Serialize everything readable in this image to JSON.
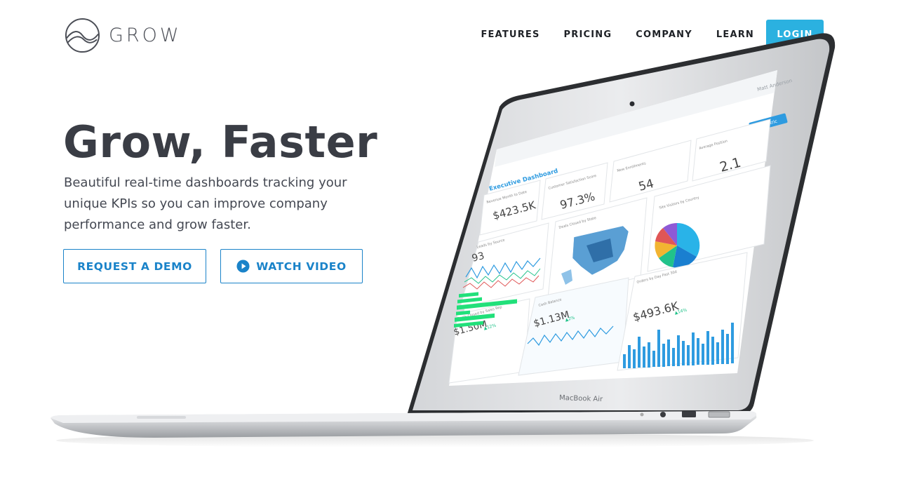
{
  "brand": {
    "name": "GROW"
  },
  "nav": {
    "items": [
      {
        "label": "FEATURES"
      },
      {
        "label": "PRICING"
      },
      {
        "label": "COMPANY"
      },
      {
        "label": "LEARN"
      }
    ],
    "login_label": "LOGIN"
  },
  "hero": {
    "title": "Grow, Faster",
    "subtitle": "Beautiful real-time dashboards tracking your unique KPIs so you can improve company performance and grow faster.",
    "demo_label": "REQUEST A DEMO",
    "video_label": "WATCH VIDEO"
  },
  "colors": {
    "accent": "#2bb1e0",
    "link": "#1a83c9",
    "text": "#3a3d45",
    "chart_blue": "#2e9be0",
    "chart_green": "#21e07a"
  },
  "laptop": {
    "model": "MacBook Air",
    "dashboard": {
      "user": "Matt Anderson",
      "add_button": "Add Metric",
      "title": "Executive Dashboard",
      "widgets": {
        "revenue": {
          "title": "Revenue Month to Date",
          "value": "$423.5K"
        },
        "csat": {
          "title": "Customer Satisfaction Score",
          "value": "97.3%"
        },
        "enroll": {
          "title": "New Enrollments",
          "value": "54"
        },
        "position": {
          "title": "Average Position",
          "value": "2.1"
        },
        "leads": {
          "title": "Leads by Source",
          "value": "93"
        },
        "state": {
          "title": "Deals Closed by State"
        },
        "visitors": {
          "title": "Site Visitors by Country"
        },
        "deals_rep": {
          "title": "Deals Closed by Sales Rep",
          "value": "$1.50M",
          "change": "▲12%"
        },
        "cash": {
          "title": "Cash Balance",
          "value": "$1.13M",
          "change": "▲2%"
        },
        "orders": {
          "title": "Orders by Day Past 30d",
          "value": "$493.6K",
          "change": "▲14%"
        }
      }
    }
  }
}
